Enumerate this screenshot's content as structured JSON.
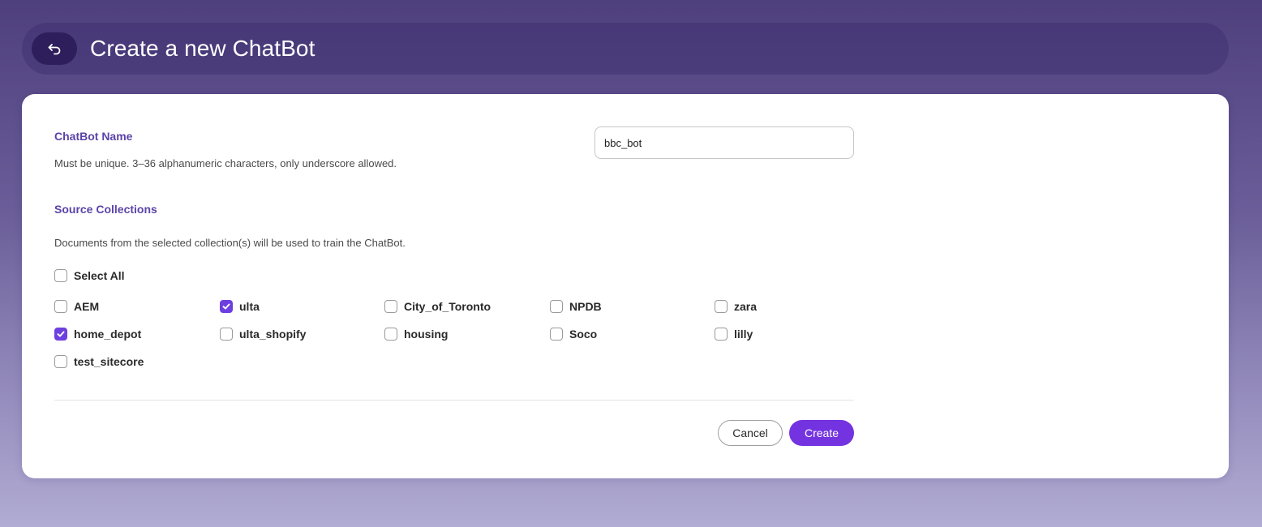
{
  "header": {
    "title": "Create a new ChatBot",
    "back_icon": "back-arrow-icon"
  },
  "name_section": {
    "title": "ChatBot Name",
    "help": "Must be unique. 3–36 alphanumeric characters, only underscore allowed.",
    "input_value": "bbc_bot"
  },
  "collections_section": {
    "title": "Source Collections",
    "help": "Documents from the selected collection(s) will be used to train the ChatBot.",
    "select_all": {
      "label": "Select All",
      "checked": false
    },
    "items": [
      {
        "label": "AEM",
        "checked": false
      },
      {
        "label": "ulta",
        "checked": true
      },
      {
        "label": "City_of_Toronto",
        "checked": false
      },
      {
        "label": "NPDB",
        "checked": false
      },
      {
        "label": "zara",
        "checked": false
      },
      {
        "label": "home_depot",
        "checked": true
      },
      {
        "label": "ulta_shopify",
        "checked": false
      },
      {
        "label": "housing",
        "checked": false
      },
      {
        "label": "Soco",
        "checked": false
      },
      {
        "label": "lilly",
        "checked": false
      },
      {
        "label": "test_sitecore",
        "checked": false
      }
    ]
  },
  "actions": {
    "cancel_label": "Cancel",
    "create_label": "Create"
  },
  "colors": {
    "accent": "#7433e0",
    "section_title": "#5b43a8",
    "back_button": "#2e1e5c"
  }
}
